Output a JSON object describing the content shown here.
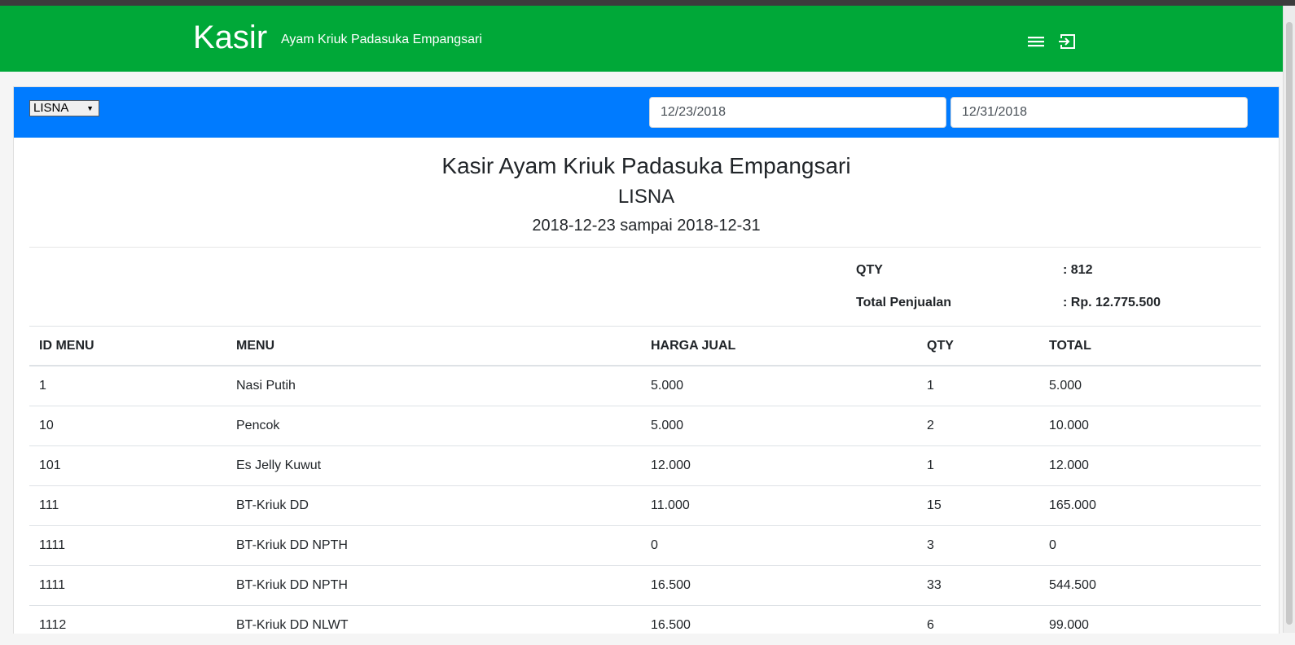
{
  "header": {
    "brand": "Kasir",
    "subtitle": "Ayam Kriuk Padasuka Empangsari",
    "icons": [
      "menu-icon",
      "logout-icon"
    ]
  },
  "filters": {
    "cashier_selected": "LISNA",
    "start_date": "12/23/2018",
    "end_date": "12/31/2018"
  },
  "report": {
    "title": "Kasir Ayam Kriuk Padasuka Empangsari",
    "cashier": "LISNA",
    "range": "2018-12-23 sampai 2018-12-31",
    "summary": {
      "qty_label": "QTY",
      "qty_value": ": 812",
      "total_label": "Total Penjualan",
      "total_value": ": Rp. 12.775.500"
    }
  },
  "table": {
    "headers": [
      "ID MENU",
      "MENU",
      "HARGA JUAL",
      "QTY",
      "TOTAL"
    ],
    "rows": [
      [
        "1",
        "Nasi Putih",
        "5.000",
        "1",
        "5.000"
      ],
      [
        "10",
        "Pencok",
        "5.000",
        "2",
        "10.000"
      ],
      [
        "101",
        "Es Jelly Kuwut",
        "12.000",
        "1",
        "12.000"
      ],
      [
        "111",
        "BT-Kriuk DD",
        "11.000",
        "15",
        "165.000"
      ],
      [
        "1111",
        "BT-Kriuk DD NPTH",
        "0",
        "3",
        "0"
      ],
      [
        "1111",
        "BT-Kriuk DD NPTH",
        "16.500",
        "33",
        "544.500"
      ],
      [
        "1112",
        "BT-Kriuk DD NLWT",
        "16.500",
        "6",
        "99.000"
      ]
    ]
  },
  "colors": {
    "navbar": "#00a838",
    "card_header": "#007bff"
  }
}
